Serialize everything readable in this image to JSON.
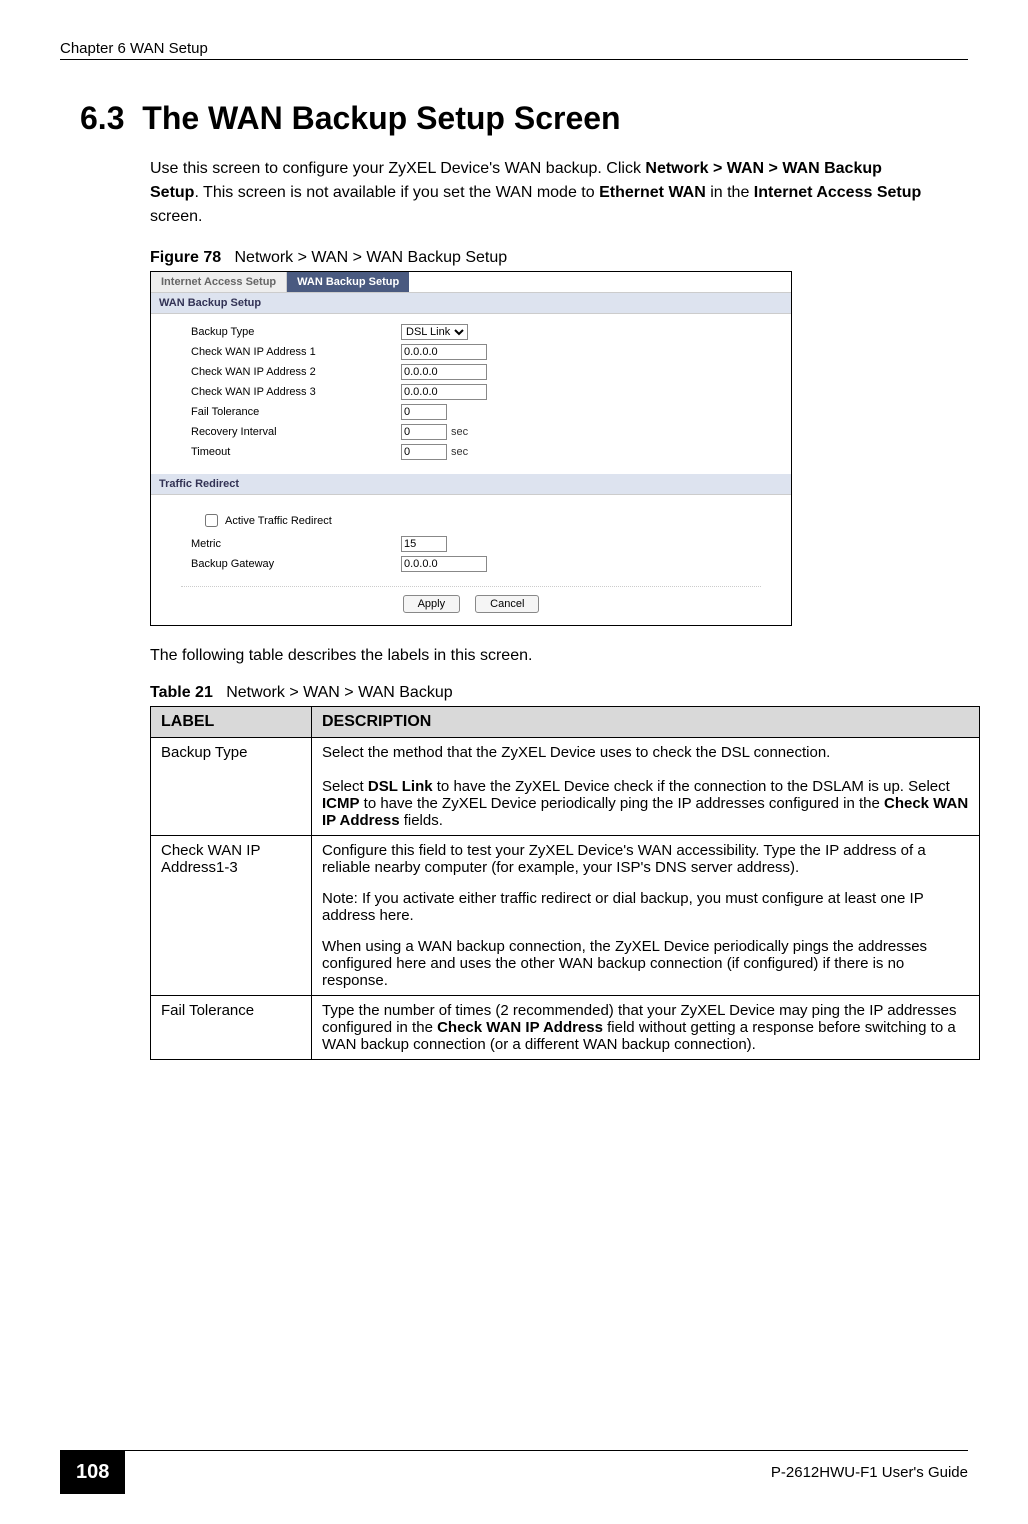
{
  "header": {
    "chapter": "Chapter 6 WAN Setup"
  },
  "section": {
    "number": "6.3",
    "title": "The WAN Backup Setup Screen"
  },
  "intro_paragraph": {
    "part1": "Use this screen to configure your ZyXEL Device's WAN backup. Click ",
    "bold1": "Network > WAN > WAN Backup Setup",
    "part2": ". This screen is not available if you set the WAN mode to ",
    "bold2": "Ethernet WAN",
    "part3": " in the ",
    "bold3": "Internet Access Setup",
    "part4": " screen."
  },
  "figure": {
    "label": "Figure 78",
    "caption": "Network > WAN > WAN Backup Setup"
  },
  "screenshot": {
    "tabs": {
      "inactive": "Internet Access Setup",
      "active": "WAN Backup Setup"
    },
    "section1_header": "WAN Backup Setup",
    "fields": {
      "backup_type_label": "Backup Type",
      "backup_type_value": "DSL Link",
      "check_ip1_label": "Check WAN IP Address  1",
      "check_ip1_value": "0.0.0.0",
      "check_ip2_label": "Check WAN IP Address  2",
      "check_ip2_value": "0.0.0.0",
      "check_ip3_label": "Check WAN IP Address  3",
      "check_ip3_value": "0.0.0.0",
      "fail_tol_label": "Fail Tolerance",
      "fail_tol_value": "0",
      "recovery_label": "Recovery Interval",
      "recovery_value": "0",
      "recovery_unit": "sec",
      "timeout_label": "Timeout",
      "timeout_value": "0",
      "timeout_unit": "sec"
    },
    "section2_header": "Traffic Redirect",
    "traffic": {
      "active_label": "Active Traffic Redirect",
      "metric_label": "Metric",
      "metric_value": "15",
      "gateway_label": "Backup Gateway",
      "gateway_value": "0.0.0.0"
    },
    "buttons": {
      "apply": "Apply",
      "cancel": "Cancel"
    }
  },
  "post_figure_text": "The following table describes the labels in this screen.",
  "table": {
    "label": "Table 21",
    "caption": "Network > WAN > WAN Backup",
    "headers": {
      "label": "LABEL",
      "description": "DESCRIPTION"
    },
    "rows": [
      {
        "label": "Backup Type",
        "desc_p1": "Select the method that the ZyXEL Device uses to check the DSL connection.",
        "desc_p2a": "Select ",
        "desc_p2b": "DSL Link",
        "desc_p2c": " to have the ZyXEL Device check if the connection to the DSLAM is up. Select ",
        "desc_p2d": "ICMP",
        "desc_p2e": " to have the ZyXEL Device periodically ping the IP addresses configured in the ",
        "desc_p2f": "Check WAN IP Address",
        "desc_p2g": " fields."
      },
      {
        "label": "Check WAN IP Address1-3",
        "desc_p1": "Configure this field to test your ZyXEL Device's WAN accessibility. Type the IP address of a reliable nearby computer (for example, your ISP's DNS server address).",
        "note": "Note: If you activate either traffic redirect or dial backup, you must configure at least one IP address here.",
        "desc_p2": "When using a WAN backup connection, the ZyXEL Device periodically pings the addresses configured here and uses the other WAN backup connection (if configured) if there is no response."
      },
      {
        "label": "Fail Tolerance",
        "desc_p1a": "Type the number of times (2 recommended) that your ZyXEL Device may ping the IP addresses configured in the ",
        "desc_p1b": "Check WAN IP Address",
        "desc_p1c": " field without getting a response before switching to a WAN backup connection (or a different WAN backup connection)."
      }
    ]
  },
  "footer": {
    "page_number": "108",
    "guide": "P-2612HWU-F1 User's Guide"
  }
}
